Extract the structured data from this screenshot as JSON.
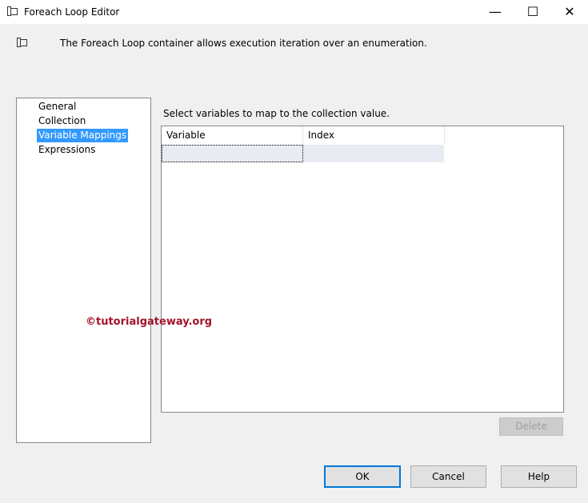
{
  "window": {
    "title": "Foreach Loop Editor",
    "minimize": "—",
    "maximize": "☐",
    "close": "✕"
  },
  "description": "The Foreach Loop container allows execution iteration over an enumeration.",
  "nav": {
    "items": [
      "General",
      "Collection",
      "Variable Mappings",
      "Expressions"
    ],
    "selected": "Variable Mappings"
  },
  "main": {
    "prompt": "Select variables to map to the collection value.",
    "columns": [
      "Variable",
      "Index"
    ],
    "rows": [
      [
        "",
        ""
      ]
    ]
  },
  "buttons": {
    "delete": "Delete",
    "ok": "OK",
    "cancel": "Cancel",
    "help": "Help"
  },
  "watermark": "©tutorialgateway.org"
}
